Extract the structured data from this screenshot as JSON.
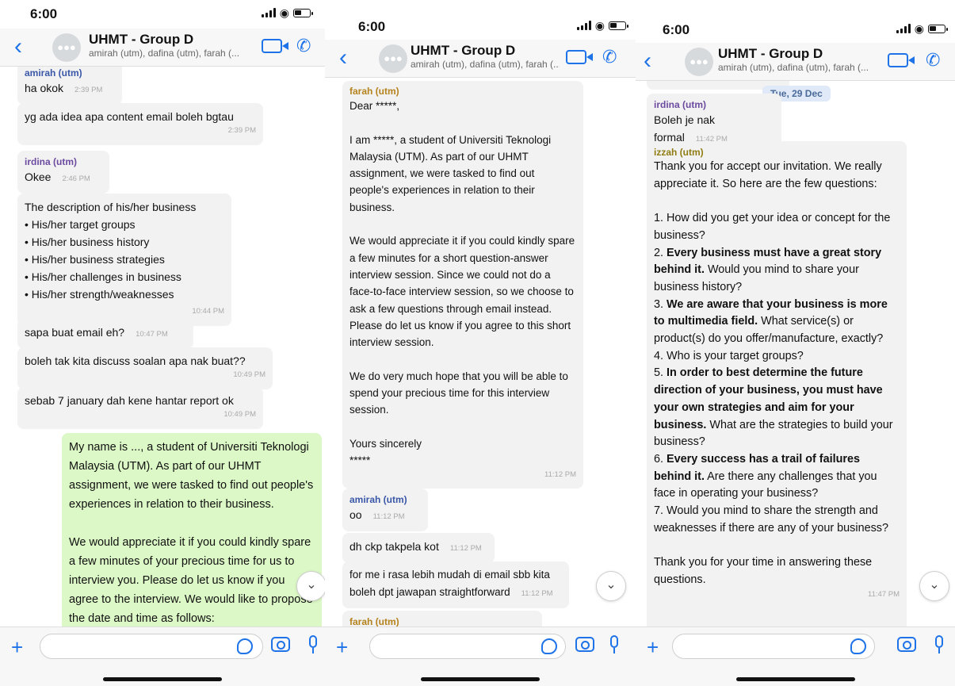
{
  "status": {
    "time": "6:00"
  },
  "chat": {
    "title": "UHMT - Group D",
    "members": "amirah (utm), dafina (utm), farah (..."
  },
  "screen1": {
    "messages": [
      {
        "sender": "amirah (utm)",
        "text": "ha okok",
        "time": "2:39 PM"
      },
      {
        "text": "yg ada idea apa content email boleh bgtau",
        "time": "2:39 PM"
      },
      {
        "sender": "irdina (utm)",
        "text": "Okee",
        "time": "2:46 PM"
      },
      {
        "text": "The description of his/her business\n• His/her target groups\n• His/her business history\n• His/her business strategies\n• His/her challenges in business\n• His/her strength/weaknesses",
        "time": "10:44 PM"
      },
      {
        "text": "sapa buat email eh?",
        "time": "10:47 PM"
      },
      {
        "text": "boleh tak kita discuss soalan apa nak buat??",
        "time": "10:49 PM"
      },
      {
        "text": "sebab 7 january dah kene hantar report ok",
        "time": "10:49 PM"
      }
    ],
    "outgoing": "My name is ..., a student of Universiti Teknologi Malaysia (UTM). As part of our UHMT assignment, we were tasked to find out people's experiences in relation to their business.\n\nWe would appreciate it if you could kindly spare a few minutes of your precious time for us to interview you. Please do let us know if you agree to the interview. We would like to propose the date and time as follows:"
  },
  "screen2": {
    "messages": [
      {
        "sender": "farah (utm)",
        "text": "Dear *****,\n\nI am *****, a student of Universiti Teknologi Malaysia (UTM). As part of our UHMT assignment, we were tasked to find out people's experiences in relation to their business.\n\nWe would appreciate it if you could kindly spare a few minutes for a short question-answer interview session. Since we could not do a face-to-face interview session, so we choose to ask a few questions through email instead. Please do let us know if you agree to this short interview session.\n\nWe do very much hope that you will be able to spend your precious time for this interview session.\n\nYours sincerely\n*****",
        "time": "11:12 PM"
      },
      {
        "sender": "amirah (utm)",
        "text": "oo",
        "time": "11:12 PM"
      },
      {
        "text": "dh ckp takpela kot",
        "time": "11:12 PM"
      },
      {
        "text": "for me i rasa lebih mudah di email sbb kita boleh dpt jawapan straightforward",
        "time": "11:12 PM"
      },
      {
        "sender": "farah (utm)"
      }
    ]
  },
  "screen3": {
    "date": "Tue, 29 Dec",
    "messages": [
      {
        "sender": "irdina (utm)",
        "text": "Boleh je nak formal",
        "time": "11:42 PM"
      },
      {
        "sender": "izzah (utm)",
        "time": "11:47 PM",
        "intro": "Thank you for accept our invitation. We really appreciate it. So here are the few questions:",
        "q1": "1.  How did you get your idea or concept for the business?",
        "q2_num": "2. ",
        "q2_bold": "Every business must have a great story behind it.",
        "q2_rest": " Would you mind to share your business history?",
        "q3_num": "3. ",
        "q3_bold": "We are aware that your business is more to multimedia field.",
        "q3_rest": " What service(s) or product(s) do you offer/manufacture, exactly?",
        "q4": "4.  Who is your target groups?",
        "q5_num": "5. ",
        "q5_bold": "In order to best determine the future direction of your business, you must have your own strategies and aim for your business.",
        "q5_rest": " What are the strategies to build your business?",
        "q6_num": "6. ",
        "q6_bold": "Every success has a trail of failures behind it.",
        "q6_rest": " Are there any challenges that you face in operating your business?",
        "q7": "7.  Would you mind to share the strength and weaknesses if there are any of your business?",
        "outro": "Thank you for your time in answering these questions."
      }
    ]
  },
  "icons": {
    "back": "chevron-left-icon",
    "video": "video-call-icon",
    "call": "phone-icon",
    "add": "plus-icon",
    "sticker": "sticker-icon",
    "camera": "camera-icon",
    "mic": "microphone-icon",
    "scroll": "chevron-down-circle-icon"
  },
  "colors": {
    "accent": "#1e73e8",
    "outgoing_bubble": "#dcf8c6",
    "incoming_bubble": "#f2f2f2"
  }
}
